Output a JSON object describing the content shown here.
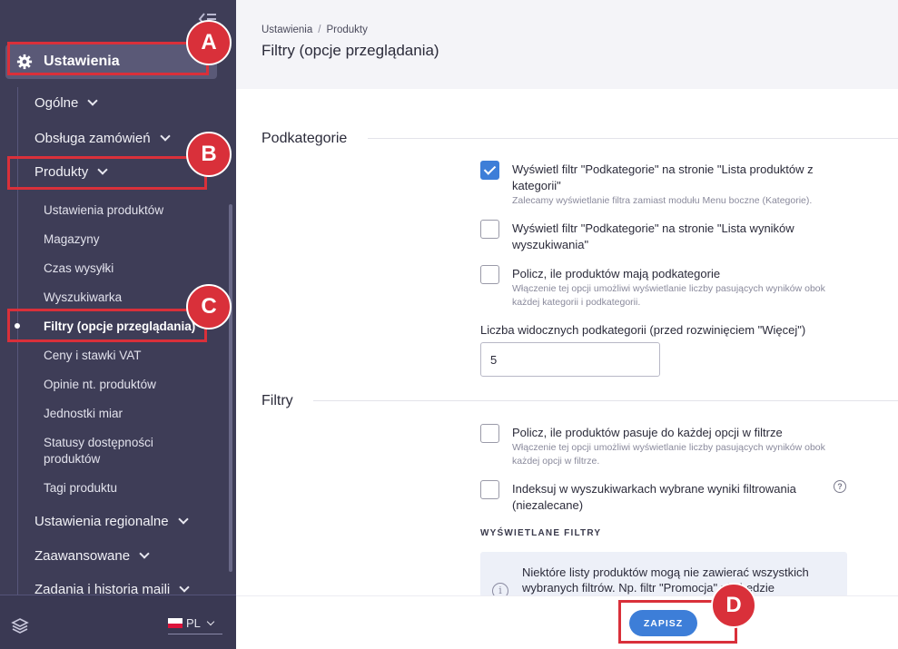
{
  "sidebar": {
    "settings_label": "Ustawienia",
    "items": [
      {
        "label": "Ogólne"
      },
      {
        "label": "Obsługa zamówień"
      },
      {
        "label": "Produkty"
      },
      {
        "label": "Ustawienia regionalne"
      },
      {
        "label": "Zaawansowane"
      },
      {
        "label": "Zadania i historia maili"
      }
    ],
    "sub_items": [
      {
        "label": "Ustawienia produktów"
      },
      {
        "label": "Magazyny"
      },
      {
        "label": "Czas wysyłki"
      },
      {
        "label": "Wyszukiwarka"
      },
      {
        "label": "Filtry (opcje przeglądania)"
      },
      {
        "label": "Ceny i stawki VAT"
      },
      {
        "label": "Opinie nt. produktów"
      },
      {
        "label": "Jednostki miar"
      },
      {
        "label": "Statusy dostępności produktów"
      },
      {
        "label": "Tagi produktu"
      }
    ],
    "language": "PL"
  },
  "header": {
    "breadcrumb": [
      "Ustawienia",
      "Produkty"
    ],
    "breadcrumb_sep": "/",
    "title": "Filtry (opcje przeglądania)"
  },
  "sections": {
    "podkategorie": {
      "title": "Podkategorie",
      "options": [
        {
          "label": "Wyświetl filtr \"Podkategorie\" na stronie \"Lista produktów z kategorii\"",
          "hint": "Zalecamy wyświetlanie filtra zamiast modułu Menu boczne (Kategorie).",
          "checked": true
        },
        {
          "label": "Wyświetl filtr \"Podkategorie\" na stronie \"Lista wyników wyszukiwania\"",
          "hint": "",
          "checked": false
        },
        {
          "label": "Policz, ile produktów mają podkategorie",
          "hint": "Włączenie tej opcji umożliwi wyświetlanie liczby pasujących wyników obok każdej kategorii i podkategorii.",
          "checked": false
        }
      ],
      "visible_count_label": "Liczba widocznych podkategorii (przed rozwinięciem \"Więcej\")",
      "visible_count_value": "5"
    },
    "filtry": {
      "title": "Filtry",
      "options": [
        {
          "label": "Policz, ile produktów pasuje do każdej opcji w filtrze",
          "hint": "Włączenie tej opcji umożliwi wyświetlanie liczby pasujących wyników obok każdej opcji w filtrze.",
          "checked": false
        },
        {
          "label": "Indeksuj w wyszukiwarkach wybrane wyniki filtrowania (niezalecane)",
          "hint": "",
          "checked": false
        }
      ],
      "help_glyph": "?",
      "displayed_filters_heading": "WYŚWIETLANE FILTRY",
      "info_icon_glyph": "i",
      "info_text": "Niektóre listy produktów mogą nie zawierać wszystkich wybranych filtrów. Np. filtr \"Promocja\" nie będzie"
    }
  },
  "footer": {
    "save_label": "ZAPISZ"
  },
  "annotations": [
    {
      "label": "A"
    },
    {
      "label": "B"
    },
    {
      "label": "C"
    },
    {
      "label": "D"
    }
  ],
  "colors": {
    "sidebar_bg": "#3e3d57",
    "accent": "#3d7ed8",
    "annotation": "#d9303a",
    "header_bg": "#f4f4f8"
  }
}
